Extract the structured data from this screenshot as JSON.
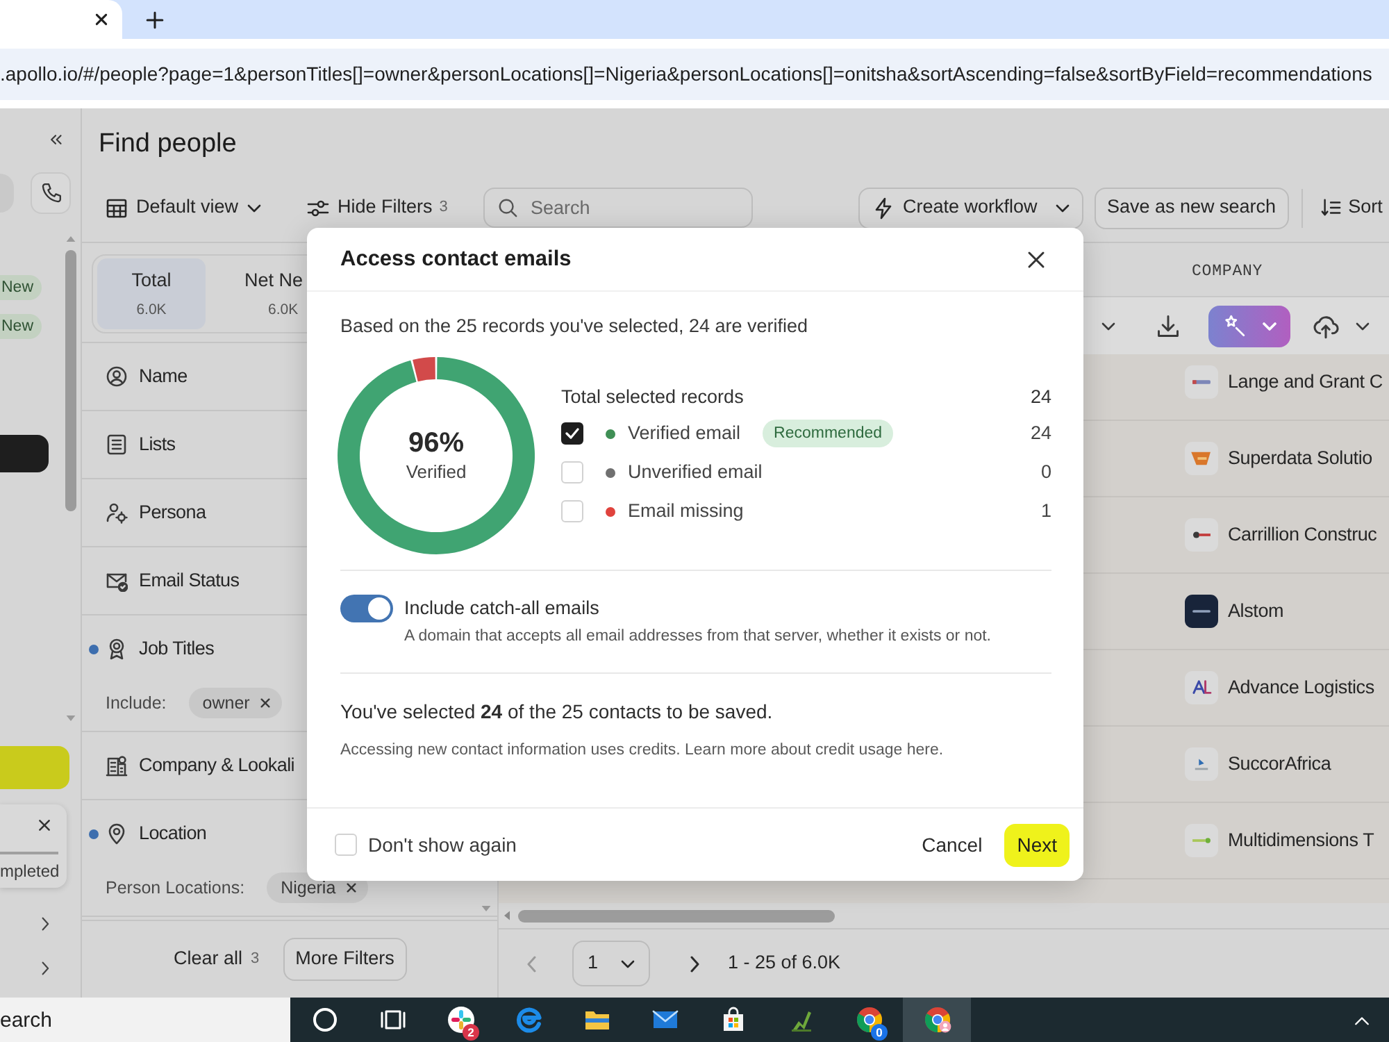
{
  "browser": {
    "url": ".apollo.io/#/people?page=1&personTitles[]=owner&personLocations[]=Nigeria&personLocations[]=onitsha&sortAscending=false&sortByField=recommendations"
  },
  "rail": {
    "badges": [
      "New",
      "New"
    ],
    "toast_text": "mpleted"
  },
  "page": {
    "title": "Find people"
  },
  "toolbar": {
    "view_label": "Default view",
    "filters_label": "Hide Filters",
    "filters_count": "3",
    "search_placeholder": "Search",
    "workflow_label": "Create workflow",
    "save_label": "Save as new search",
    "sort_label": "Sort"
  },
  "count_tabs": [
    {
      "label": "Total",
      "count": "6.0K",
      "selected": true
    },
    {
      "label": "Net Ne",
      "count": "6.0K",
      "selected": false
    }
  ],
  "filters": [
    {
      "label": "Name",
      "active": false
    },
    {
      "label": "Lists",
      "active": false
    },
    {
      "label": "Persona",
      "active": false
    },
    {
      "label": "Email Status",
      "active": false
    },
    {
      "label": "Job Titles",
      "active": true,
      "chips": {
        "label": "Include:",
        "values": [
          "owner"
        ]
      }
    },
    {
      "label": "Company & Lookali",
      "active": false
    },
    {
      "label": "Location",
      "active": true,
      "chips": {
        "label": "Person Locations:",
        "values": [
          "Nigeria"
        ]
      }
    }
  ],
  "filter_footer": {
    "clear_label": "Clear all",
    "clear_count": "3",
    "more_label": "More Filters"
  },
  "table": {
    "columns": [
      "COMPANY"
    ],
    "rows": [
      {
        "company": "Lange and Grant C"
      },
      {
        "company": "Superdata Solutio"
      },
      {
        "company": "Carrillion Construc"
      },
      {
        "company": "Alstom"
      },
      {
        "company": "Advance Logistics"
      },
      {
        "company": "SuccorAfrica"
      },
      {
        "company": "Multidimensions T"
      }
    ]
  },
  "pagination": {
    "prev_disabled": true,
    "page": "1",
    "next_disabled": false,
    "range": "1 - 25 of 6.0K"
  },
  "modal": {
    "title": "Access contact emails",
    "intro": "Based on the 25 records you've selected, 24 are verified",
    "chart": {
      "chart_data": {
        "type": "donut",
        "categories": [
          "Verified email",
          "Unverified email",
          "Email missing"
        ],
        "values": [
          96,
          0,
          4
        ]
      },
      "center_value": "96%",
      "center_label": "Verified"
    },
    "legend": {
      "total_label": "Total selected records",
      "total_count": "24",
      "rows": [
        {
          "badge": "Recommended",
          "count": "24",
          "checked": true,
          "color": "#3f8f55"
        },
        {
          "count": "0",
          "checked": false,
          "color": "#707070"
        },
        {
          "count": "1",
          "checked": false,
          "color": "#e0433d"
        }
      ]
    },
    "catch_all": {
      "label": "Include catch-all emails",
      "description": "A domain that accepts all email addresses from that server, whether it exists or not.",
      "on": true
    },
    "summary": "You've selected **24** of the 25 contacts to be saved.",
    "note": "Accessing new contact information uses credits. Learn more about credit usage here.",
    "dont_show": {
      "label": "Don't show again",
      "checked": false
    },
    "cancel_label": "Cancel",
    "next_label": "Next"
  },
  "taskbar": {
    "search_placeholder": "earch",
    "apps": [
      {
        "kind": "cortana",
        "active": false
      },
      {
        "kind": "task-view",
        "active": false
      },
      {
        "kind": "slack",
        "badge": "2",
        "active": false
      },
      {
        "kind": "edge",
        "active": false
      },
      {
        "kind": "folder",
        "active": false
      },
      {
        "kind": "mail",
        "active": false
      },
      {
        "kind": "store",
        "active": false
      },
      {
        "kind": "green-app",
        "active": false
      },
      {
        "kind": "chrome",
        "badge": "0",
        "active": false
      },
      {
        "kind": "chrome-profile",
        "active": true
      }
    ]
  }
}
